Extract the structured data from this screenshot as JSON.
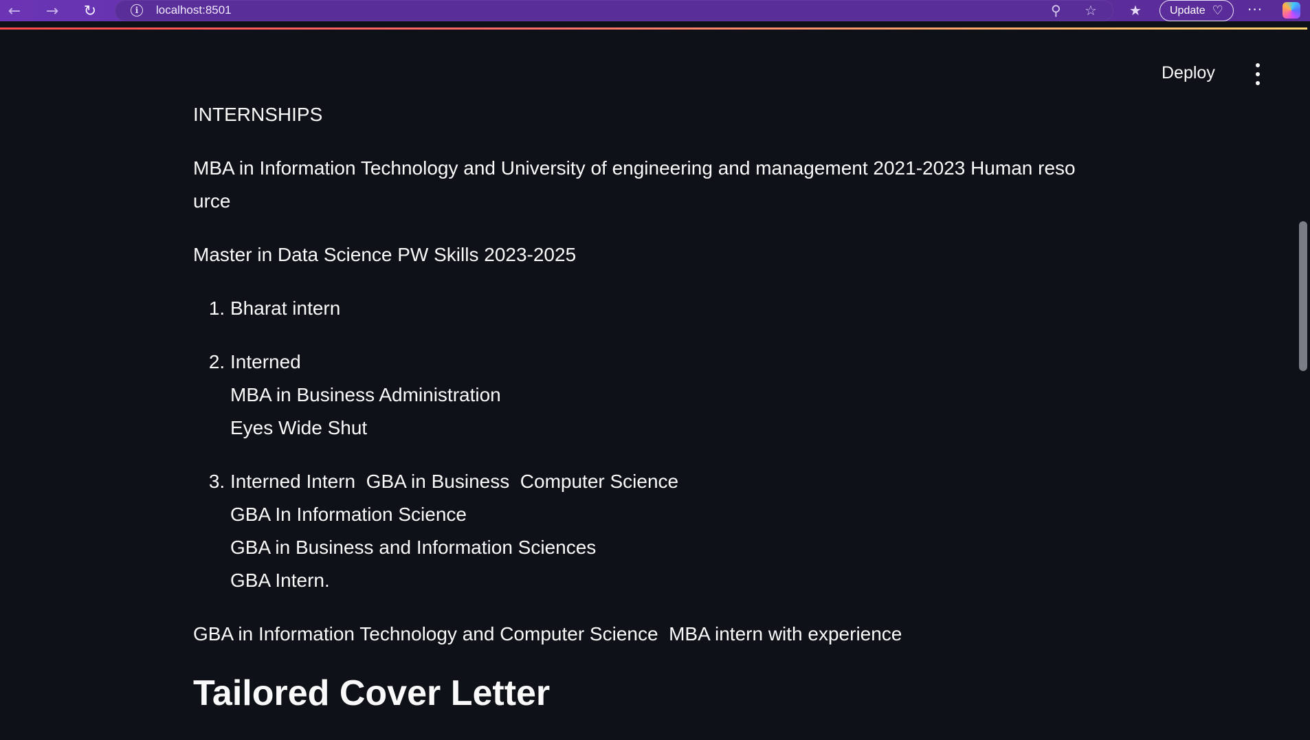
{
  "browser": {
    "url": "localhost:8501",
    "update_label": "Update",
    "colors": {
      "bar": "#5d2f9e",
      "accent_start": "#ff4b4b",
      "accent_end": "#ffd36b"
    }
  },
  "app_header": {
    "deploy_label": "Deploy"
  },
  "content": {
    "section_heading": "INTERNSHIPS",
    "paragraph_1": "MBA in Information Technology and University of engineering and management 2021-2023 Human resource",
    "paragraph_2": "Master in Data Science PW Skills 2023-2025",
    "list": [
      {
        "lines": [
          "Bharat intern"
        ]
      },
      {
        "lines": [
          "Interned",
          "MBA in Business Administration",
          "Eyes Wide Shut"
        ]
      },
      {
        "lines": [
          "Interned Intern  GBA in Business  Computer Science",
          "GBA In Information Science",
          "GBA in Business and Information Sciences",
          "GBA Intern."
        ]
      }
    ],
    "paragraph_3": "GBA in Information Technology and Computer Science  MBA intern with experience",
    "title": "Tailored Cover Letter"
  },
  "theme": {
    "background": "#0e1117",
    "text": "#fafafa"
  }
}
